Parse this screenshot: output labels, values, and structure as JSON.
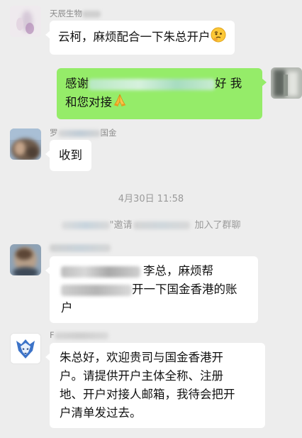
{
  "messages": [
    {
      "sender_prefix": "天辰生物",
      "text": "云柯，麻烦配合一下朱总开户",
      "emoji": "thinking-face"
    },
    {
      "line1_prefix": "感谢",
      "line1_suffix": "好 我",
      "line2": "和您对接",
      "emoji": "folded-hands"
    },
    {
      "sender_prefix": "罗",
      "sender_suffix": "国金",
      "text": "收到"
    },
    {
      "timestamp": "4月30日 11:58",
      "invite_text": "\"邀请",
      "joined_text": "加入了群聊"
    },
    {
      "line1_visible": "李总，麻烦帮",
      "line2_visible": "开一下国金香港的账",
      "line3": "户"
    },
    {
      "sender_prefix": "F",
      "lines": [
        "朱总好，欢迎贵司与国金香港开",
        "户。请提供开户主体全称、注册",
        "地、开户对接人邮箱，我待会把开",
        "户清单发过去。"
      ]
    }
  ],
  "colors": {
    "background": "#ededed",
    "incoming_bubble": "#ffffff",
    "outgoing_bubble": "#95ec69",
    "meta_text": "#8a8a8a",
    "system_text": "#9a9a9a"
  }
}
